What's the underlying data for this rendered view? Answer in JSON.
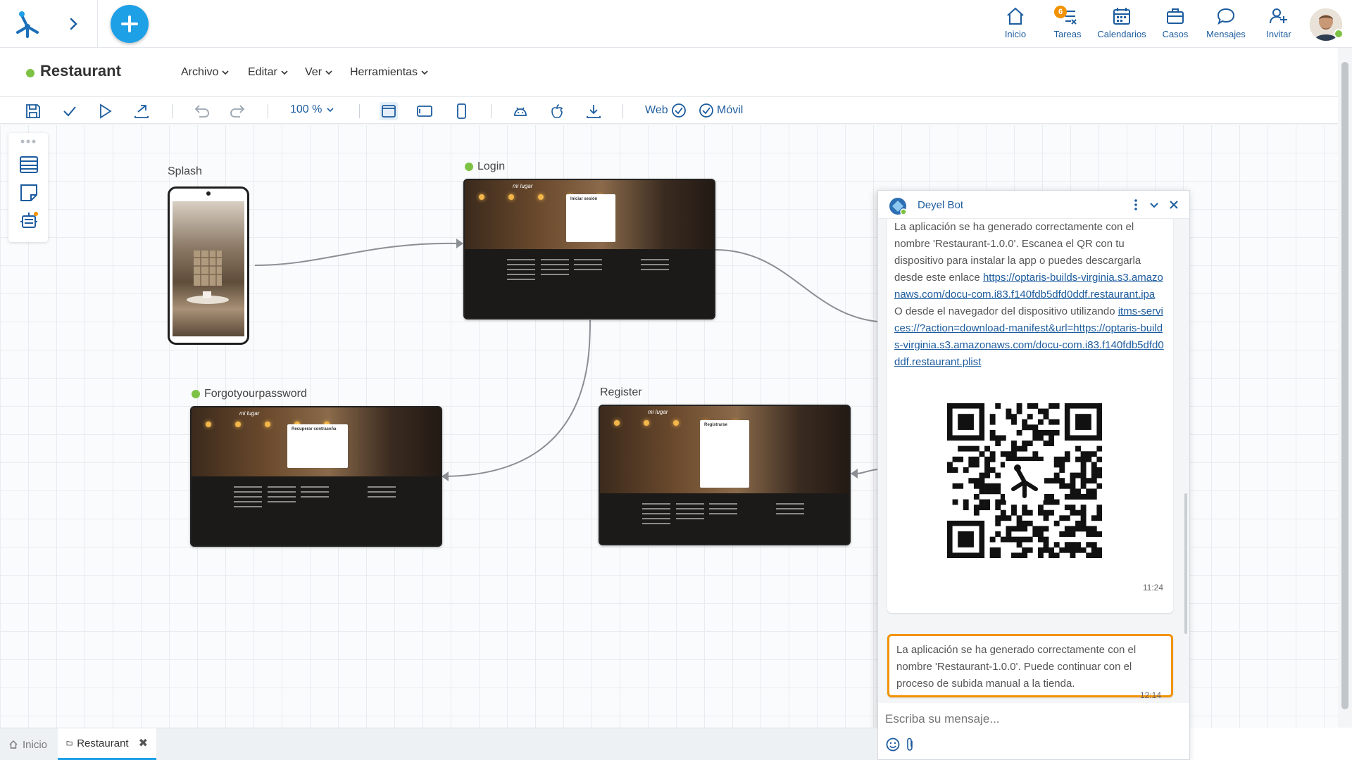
{
  "topnav": {
    "items": [
      {
        "label": "Inicio",
        "icon": "home-icon"
      },
      {
        "label": "Tareas",
        "icon": "tasks-icon",
        "badge": "6"
      },
      {
        "label": "Calendarios",
        "icon": "calendar-icon"
      },
      {
        "label": "Casos",
        "icon": "briefcase-icon"
      },
      {
        "label": "Mensajes",
        "icon": "chat-bubble-icon"
      },
      {
        "label": "Invitar",
        "icon": "invite-user-icon"
      }
    ]
  },
  "app": {
    "title": "Restaurant",
    "status_color": "#7dc244",
    "menus": [
      "Archivo",
      "Editar",
      "Ver",
      "Herramientas"
    ]
  },
  "toolbar": {
    "zoom": "100 %",
    "web_label": "Web",
    "mobile_label": "Móvil"
  },
  "canvas": {
    "nodes": {
      "splash": "Splash",
      "login": "Login",
      "forgot": "Forgotyourpassword",
      "register": "Register"
    },
    "mock": {
      "brand": "mi lugar",
      "login_dialog": "Iniciar sesión",
      "forgot_dialog": "Recuperar contraseña",
      "register_dialog": "Registrarse"
    }
  },
  "chat": {
    "bot_name": "Deyel Bot",
    "messages": [
      {
        "text_before": "La aplicación se ha generado correctamente con el nombre 'Restaurant-1.0.0'. Escanea el QR con tu dispositivo para instalar la app o puedes descargarla desde este enlace ",
        "link1": "https://optaris-builds-virginia.s3.amazonaws.com/docu-com.i83.f140fdb5dfd0ddf.restaurant.ipa",
        "text_middle": " O desde el navegador del dispositivo utilizando ",
        "link2": "itms-services://?action=download-manifest&url=https://optaris-builds-virginia.s3.amazonaws.com/docu-com.i83.f140fdb5dfd0ddf.restaurant.plist",
        "time": "11:24"
      },
      {
        "text": "La aplicación se ha generado correctamente con el nombre 'Restaurant-1.0.0'. Puede continuar con el proceso de subida manual a la tienda.",
        "time": "12:14"
      }
    ],
    "input_placeholder": "Escriba su mensaje..."
  },
  "tabs": [
    {
      "label": "Inicio"
    },
    {
      "label": "Restaurant"
    }
  ],
  "colors": {
    "accent": "#1ea0e6",
    "nav_text": "#1c5c9e",
    "highlight": "#f39200",
    "status_green": "#7dc244"
  }
}
